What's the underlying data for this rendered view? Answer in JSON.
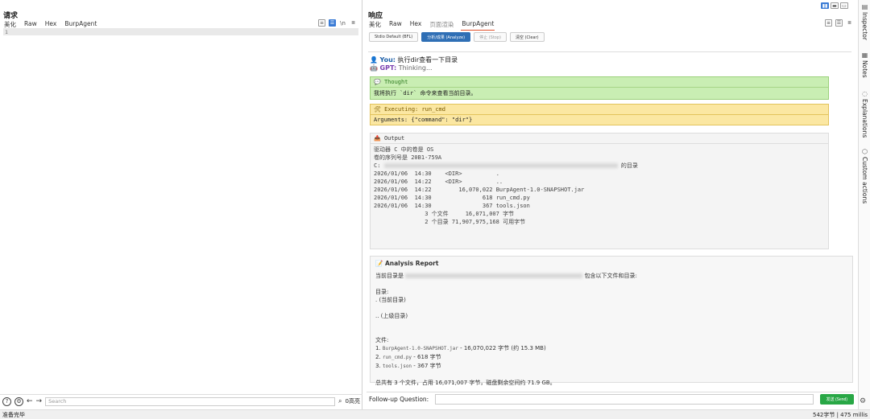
{
  "request": {
    "title": "请求",
    "tabs": [
      "美化",
      "Raw",
      "Hex",
      "BurpAgent"
    ],
    "active_tab": "Raw",
    "line_number": "1",
    "search_placeholder": "Search",
    "highlight_count": "0高亮",
    "tool_in": "\\n"
  },
  "response": {
    "title": "响应",
    "tabs": [
      "美化",
      "Raw",
      "Hex",
      "页面渲染",
      "BurpAgent"
    ],
    "active_tab": "BurpAgent",
    "actions": [
      "Stdio Default (BFL)",
      "分析/成果 (Analyze)",
      "停止 (Stop)",
      "清空 (Clear)"
    ],
    "chat": {
      "you_label": "You:",
      "you_text": "执行dir查看一下目录",
      "gpt_label": "GPT:",
      "gpt_text": "Thinking..."
    },
    "thought": {
      "header": "Thought",
      "body": "我将执行 `dir` 命令来查看当前目录。"
    },
    "executing": {
      "header": "Executing: run_cmd",
      "body": "Arguments: {\"command\": \"dir\"}"
    },
    "output": {
      "header": "Output",
      "lines": [
        "驱动器 C 中的卷是 OS",
        "卷的序列号是 20B1-759A",
        "",
        "C:",
        "",
        "2026/01/06  14:30    <DIR>          .",
        "2026/01/06  14:22    <DIR>          ..",
        "2026/01/06  14:22        16,070,022 BurpAgent-1.0-SNAPSHOT.jar",
        "2026/01/06  14:30               618 run_cmd.py",
        "2026/01/06  14:30               367 tools.json",
        "               3 个文件     16,071,007 字节",
        "               2 个目录 71,907,975,168 可用字节"
      ],
      "dir_suffix": "的目录"
    },
    "report": {
      "header": "Analysis Report",
      "intro_prefix": "当前目录是",
      "intro_suffix": "包含以下文件和目录:",
      "dirs_label": "目录:",
      "dir1": ". (当前目录)",
      "dir2": ".. (上级目录)",
      "files_label": "文件:",
      "file1_num": "1.",
      "file1_name": "BurpAgent-1.0-SNAPSHOT.jar",
      "file1_desc": "- 16,070,022 字节 (约 15.3 MB)",
      "file2_num": "2.",
      "file2_name": "run_cmd.py",
      "file2_desc": "- 618 字节",
      "file3_num": "3.",
      "file3_name": "tools.json",
      "file3_desc": "- 367 字节",
      "summary": "总共有 3 个文件，占用 16,071,007 字节，磁盘剩余空间约 71.9 GB。"
    },
    "followup_label": "Follow-up Question:",
    "followup_value": "",
    "send_label": "发送 (Send)"
  },
  "sidebar": [
    "Inspector",
    "Notes",
    "Explanations",
    "Custom actions"
  ],
  "status": {
    "left": "准备完毕",
    "right": "542字节 | 475 millis"
  },
  "colors": {
    "accent_tab": "#e0502a",
    "primary_button": "#2f6fb5",
    "thought_bg": "#c9eeb3",
    "exec_bg": "#fbe7a2",
    "send_button": "#28a745"
  }
}
